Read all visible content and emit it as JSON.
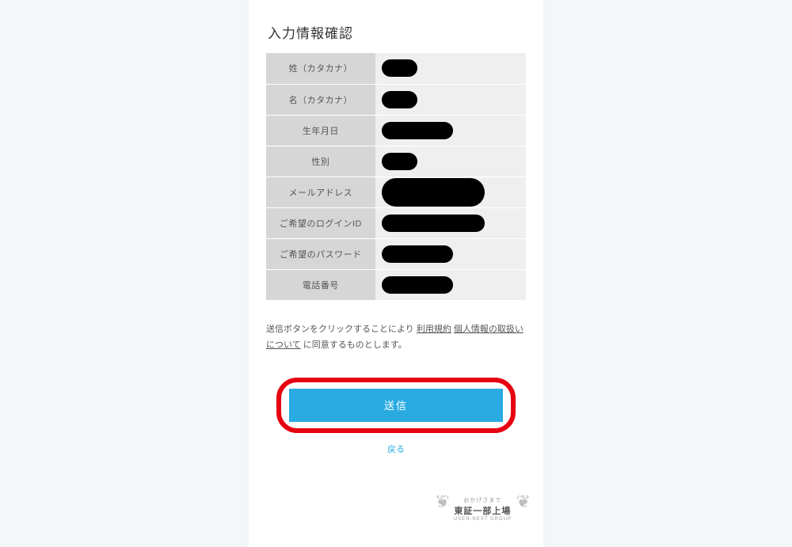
{
  "page_title": "入力情報確認",
  "fields": [
    {
      "label": "姓（カタカナ）",
      "redact_class": "w-small"
    },
    {
      "label": "名（カタカナ）",
      "redact_class": "w-small"
    },
    {
      "label": "生年月日",
      "redact_class": "w-med"
    },
    {
      "label": "性別",
      "redact_class": "w-small"
    },
    {
      "label": "メールアドレス",
      "redact_class": "w-large w-tall"
    },
    {
      "label": "ご希望のログインID",
      "redact_class": "w-large"
    },
    {
      "label": "ご希望のパスワード",
      "redact_class": "w-med"
    },
    {
      "label": "電話番号",
      "redact_class": "w-med"
    }
  ],
  "consent": {
    "prefix": "送信ボタンをクリックすることにより ",
    "terms_link": "利用規約",
    "privacy_link": "個人情報の取扱いについて",
    "suffix": " に同意するものとします。"
  },
  "submit_label": "送信",
  "back_label": "戻る",
  "footer_badge": {
    "lead": "おかげさまで",
    "main": "東証一部上場",
    "sub": "USEN-NEXT GROUP"
  }
}
